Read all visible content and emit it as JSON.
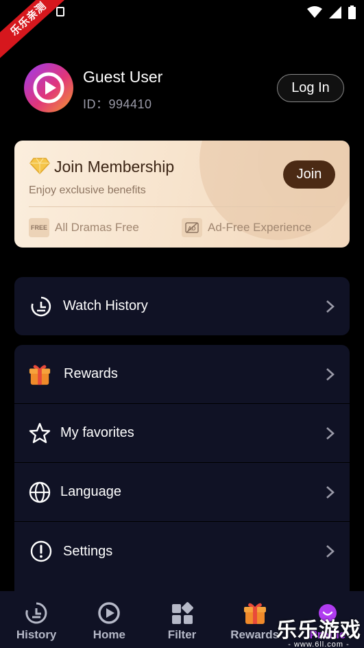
{
  "status_bar": {
    "ribbon_text": "乐乐亲测"
  },
  "profile": {
    "username": "Guest User",
    "user_id": "ID：994410",
    "login_label": "Log In"
  },
  "membership": {
    "title": "Join Membership",
    "subtitle": "Enjoy exclusive benefits",
    "join_label": "Join",
    "benefits": [
      {
        "icon_text": "FREE",
        "label": "All Dramas Free"
      },
      {
        "icon_text": "AD",
        "label": "Ad-Free Experience"
      }
    ]
  },
  "menu": {
    "history": {
      "label": "Watch History",
      "icon": "history-icon"
    },
    "items": [
      {
        "label": "Rewards",
        "icon": "gift-icon"
      },
      {
        "label": "My favorites",
        "icon": "star-icon"
      },
      {
        "label": "Language",
        "icon": "globe-icon"
      },
      {
        "label": "Settings",
        "icon": "info-icon"
      }
    ]
  },
  "bottom_nav": [
    {
      "label": "History",
      "icon": "history-icon"
    },
    {
      "label": "Home",
      "icon": "play-icon"
    },
    {
      "label": "Filter",
      "icon": "grid-icon"
    },
    {
      "label": "Rewards",
      "icon": "gift-icon"
    },
    {
      "label": "Profile",
      "icon": "avatar-icon"
    }
  ],
  "watermark": {
    "title": "乐乐游戏",
    "url": "- www.6ll.com -"
  },
  "colors": {
    "background": "#000000",
    "card": "#101225",
    "member_bg": "#f6e1c9",
    "join_button": "#4b2a14",
    "ribbon": "#d6171d"
  }
}
